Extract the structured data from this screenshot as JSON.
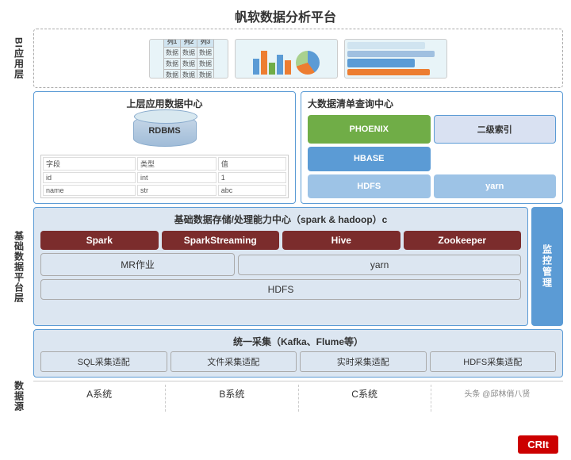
{
  "title": "帆软数据分析平台",
  "layers": {
    "bi_label": "BI应用层",
    "foundation_label": "基础\n数据\n平台\n层",
    "datasource_label": "数据源"
  },
  "top_center": {
    "title": "帆软数据分析平台"
  },
  "left_data_center": {
    "title": "上层应用数据中心",
    "rdbms": "RDBMS"
  },
  "right_data_center": {
    "title": "大数据清单查询中心",
    "items": [
      {
        "label": "PHOENIX",
        "style": "green"
      },
      {
        "label": "二级索引",
        "style": "secondary"
      },
      {
        "label": "HBASE",
        "style": "blue"
      },
      {
        "label": "",
        "style": "empty"
      },
      {
        "label": "HDFS",
        "style": "light-blue"
      },
      {
        "label": "yarn",
        "style": "light-blue"
      }
    ]
  },
  "foundation": {
    "title": "基础数据存储/处理能力中心（spark & hadoop）c",
    "tech_items": [
      "Spark",
      "SparkStreaming",
      "Hive",
      "Zookeeper"
    ],
    "mr_label": "MR作业",
    "yarn_label": "yarn",
    "hdfs_label": "HDFS",
    "monitor_label": "监控管理"
  },
  "collection": {
    "title": "统一采集（Kafka、Flume等）",
    "items": [
      "SQL采集适配",
      "文件采集适配",
      "实时采集适配",
      "HDFS采集适配"
    ]
  },
  "datasources": [
    "A系统",
    "B系统",
    "C系统",
    "头条 @邱林俏八贤"
  ],
  "watermark": "头条 @邱林俏八贤",
  "crit": "CRIt"
}
